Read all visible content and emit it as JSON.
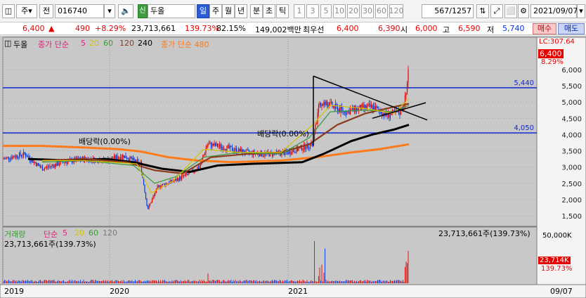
{
  "toolbar": {
    "market_type": "주",
    "prev_label": "전",
    "code": "016740",
    "stock_name": "두올",
    "stock_prefix": "신",
    "periods": [
      "일",
      "주",
      "월",
      "년",
      "분",
      "초",
      "틱"
    ],
    "selected_period": "일",
    "intervals": [
      "1",
      "3",
      "5",
      "10",
      "20",
      "30",
      "60",
      "120"
    ],
    "position": "567",
    "total": "/1257",
    "date": "2021/09/07"
  },
  "quote": {
    "price": "6,400",
    "arrow": "▲",
    "change": "490",
    "change_pct": "+8.29%",
    "volume": "23,713,661",
    "volume_ratio": "139.73%",
    "turnover": "82.15%",
    "amount": "149,002백만",
    "priority_label": "최우선",
    "ask": "6,400",
    "bid": "6,390",
    "open_label": "시",
    "open": "6,000",
    "high_label": "고",
    "high": "6,590",
    "low_label": "저",
    "low": "5,740",
    "buy_label": "매수",
    "sell_label": "매도"
  },
  "legend": {
    "name": "두올",
    "ma_group1": "종가 단순",
    "ma5": "5",
    "ma20": "20",
    "ma60": "60",
    "ma120": "120",
    "ma240": "240",
    "ma_group2": "종가 단순 480",
    "lc": "LC:307.64",
    "price_box": "6,400",
    "price_pct": "8.29%"
  },
  "price_axis": {
    "ticks": [
      "6,000",
      "5,500",
      "5,000",
      "4,500",
      "4,000",
      "3,500",
      "3,000",
      "2,500",
      "2,000",
      "1,500"
    ],
    "hline_labels": [
      "5,440",
      "4,050"
    ]
  },
  "annotations": {
    "dividend1": "배당락(0.00%)",
    "dividend2": "배당락(0.00%)"
  },
  "volume_panel": {
    "title": "거래량",
    "ma_label": "단순",
    "ma5": "5",
    "ma20": "20",
    "ma60": "60",
    "ma120": "120",
    "value_left": "23,713,661주(139.73%)",
    "value_right": "23,713,661주(139.73%)",
    "axis_top": "50,000K",
    "axis_box": "23,714K",
    "axis_pct": "139.73%"
  },
  "time_axis": {
    "labels": [
      "2019",
      "2020",
      "2021"
    ],
    "last_date": "09/07"
  },
  "colors": {
    "up": "#e60000",
    "down": "#0036e6",
    "ma5": "#e1207a",
    "ma20": "#d4c400",
    "ma60": "#3a9a3a",
    "ma120": "#8b3a1a",
    "ma240": "#000000",
    "ma480": "#ff7a1a"
  }
}
